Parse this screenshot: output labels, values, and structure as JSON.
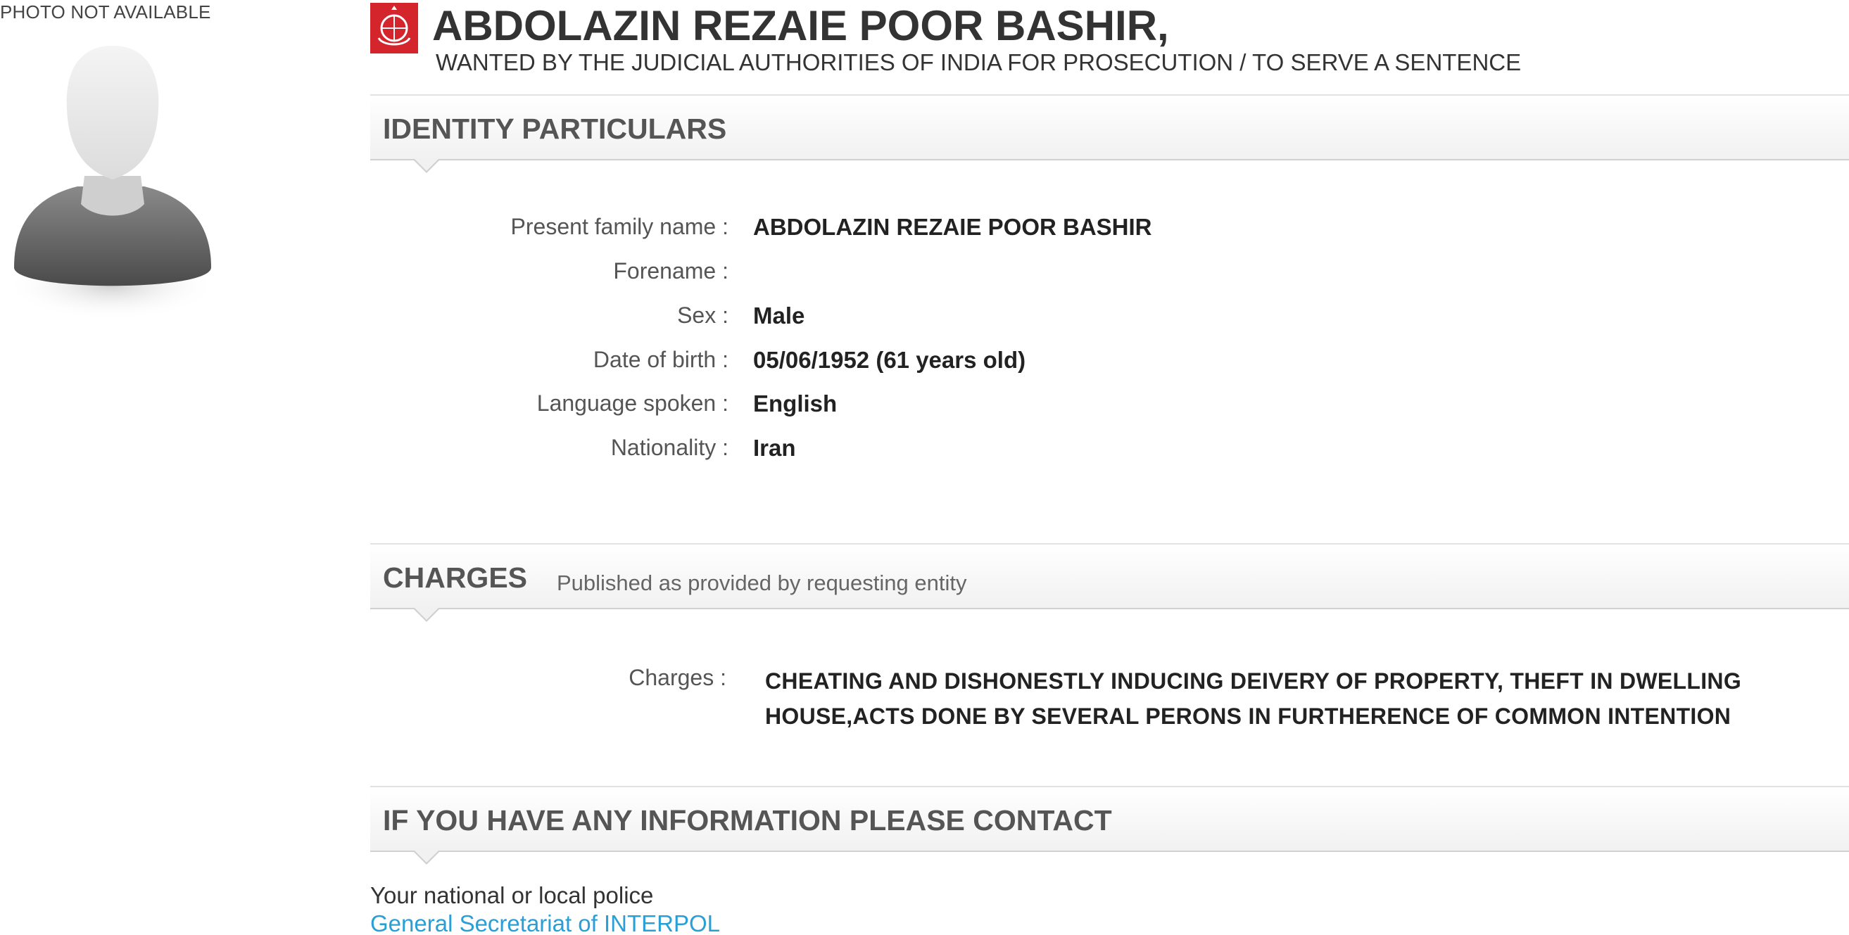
{
  "photo": {
    "label": "PHOTO NOT AVAILABLE"
  },
  "notice": {
    "name": "ABDOLAZIN REZAIE POOR BASHIR,",
    "subtitle": "WANTED BY THE JUDICIAL AUTHORITIES OF INDIA FOR PROSECUTION / TO SERVE A SENTENCE"
  },
  "identity": {
    "title": "IDENTITY PARTICULARS",
    "rows": [
      {
        "label": "Present family name :",
        "value": "ABDOLAZIN REZAIE POOR BASHIR"
      },
      {
        "label": "Forename :",
        "value": ""
      },
      {
        "label": "Sex :",
        "value": "Male"
      },
      {
        "label": "Date of birth :",
        "value": "05/06/1952 (61 years old)"
      },
      {
        "label": "Language spoken :",
        "value": "English"
      },
      {
        "label": "Nationality :",
        "value": "Iran"
      }
    ]
  },
  "charges": {
    "title": "CHARGES",
    "note": "Published as provided by requesting entity",
    "label": "Charges :",
    "lines": [
      "CHEATING AND DISHONESTLY INDUCING DEIVERY OF PROPERTY, THEFT IN DWELLING",
      "HOUSE,ACTS DONE BY SEVERAL PERONS IN FURTHERENCE OF COMMON INTENTION"
    ]
  },
  "contact": {
    "title": "IF YOU HAVE ANY INFORMATION PLEASE CONTACT",
    "text": "Your national or local police",
    "link": "General Secretariat of INTERPOL"
  },
  "colors": {
    "emblem": "#d4252c",
    "link": "#2a9fd6",
    "heading": "#555555"
  },
  "icons": {
    "emblem": "interpol-emblem-icon",
    "avatar": "person-silhouette-icon"
  }
}
